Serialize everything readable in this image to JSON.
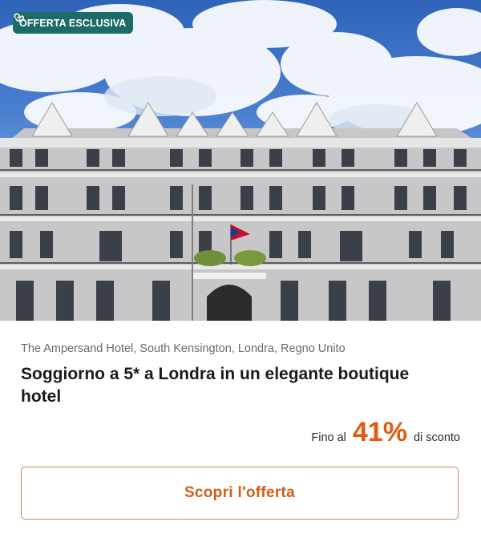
{
  "badge": {
    "label": "OFFERTA ESCLUSIVA",
    "icon": "brand-logo-icon",
    "color": "#1d6b66"
  },
  "hero": {
    "image": "hotel-facade-photo"
  },
  "offer": {
    "location": "The Ampersand Hotel, South Kensington, Londra, Regno Unito",
    "title": "Soggiorno a 5* a Londra in un elegante boutique hotel",
    "discount_prefix": "Fino al",
    "discount_value": "41%",
    "discount_suffix": "di sconto",
    "accent_color": "#e15a0d"
  },
  "cta": {
    "label": "Scopri l'offerta"
  }
}
